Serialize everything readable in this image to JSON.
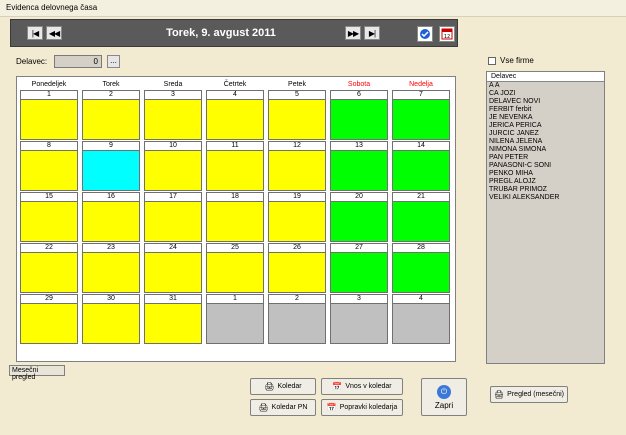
{
  "window": {
    "title": "Evidenca delovnega časa"
  },
  "nav": {
    "first_label": "|◀",
    "prev_label": "◀◀",
    "next_label": "▶▶",
    "last_label": "▶|",
    "date_title": "Torek,  9. avgust 2011",
    "icon_confirm": "check-circle-icon",
    "icon_calendar": "calendar-12-icon"
  },
  "delavec": {
    "label": "Delavec:",
    "value": "0",
    "button_label": "..."
  },
  "calendar": {
    "day_headers": [
      "Ponedeljek",
      "Torek",
      "Sreda",
      "Četrtek",
      "Petek",
      "Sobota",
      "Nedelja"
    ],
    "weekend_header_color": "#ff0000",
    "colors": {
      "workday": "#ffff00",
      "weekend": "#00ff00",
      "selected": "#00ffff",
      "other_month": "#c0c0c0"
    },
    "weeks": [
      [
        "1",
        "2",
        "3",
        "4",
        "5",
        "6",
        "7"
      ],
      [
        "8",
        "9",
        "10",
        "11",
        "12",
        "13",
        "14"
      ],
      [
        "15",
        "16",
        "17",
        "18",
        "19",
        "20",
        "21"
      ],
      [
        "22",
        "23",
        "24",
        "25",
        "26",
        "27",
        "28"
      ],
      [
        "29",
        "30",
        "31",
        "1",
        "2",
        "3",
        "4"
      ]
    ],
    "types": [
      [
        "w",
        "w",
        "w",
        "w",
        "w",
        "e",
        "e"
      ],
      [
        "w",
        "s",
        "w",
        "w",
        "w",
        "e",
        "e"
      ],
      [
        "w",
        "w",
        "w",
        "w",
        "w",
        "e",
        "e"
      ],
      [
        "w",
        "w",
        "w",
        "w",
        "w",
        "e",
        "e"
      ],
      [
        "w",
        "w",
        "w",
        "o",
        "o",
        "o",
        "o"
      ]
    ]
  },
  "vse_firme": {
    "label": "Vse firme",
    "checked": false
  },
  "employees": {
    "header": "Delavec",
    "items": [
      "A A",
      "CA JOZI",
      "DELAVEC NOVI",
      "FERBIT ferbit",
      "JE NEVENKA",
      "JERICA PERICA",
      "JURCIC JANEZ",
      "NILENA JELENA",
      "NIMONA SIMONA",
      "PAN PETER",
      "PANASONI-C SONI",
      "PENKO MIHA",
      "PREGL ALOJZ",
      "TRUBAR PRIMOZ",
      "VELIKI ALEKSANDER"
    ]
  },
  "tabs": {
    "monthly": "Mesečni pregled"
  },
  "buttons": {
    "koledar": "Koledar",
    "koledar_pn": "Koledar PN",
    "vnos": "Vnos v koledar",
    "popravki": "Popravki koledarja",
    "zapri": "Zapri",
    "pregled": "Pregled (mesečni)"
  }
}
